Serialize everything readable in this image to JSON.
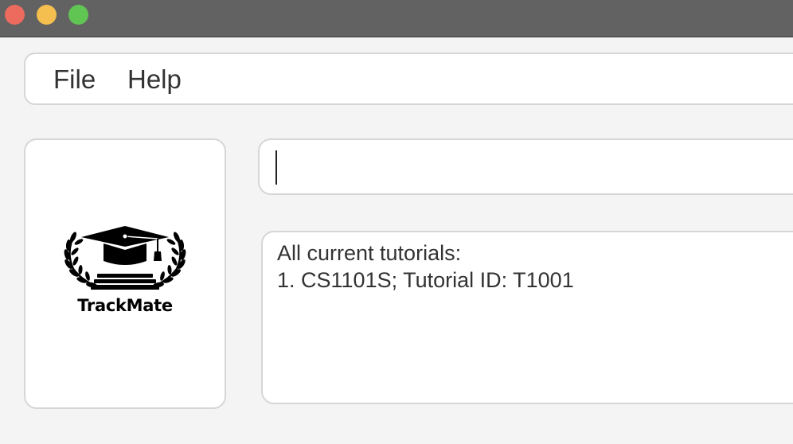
{
  "window": {
    "controls": {
      "close_color": "#ed6a5e",
      "minimize_color": "#f5bf4f",
      "zoom_color": "#61c554"
    }
  },
  "menubar": {
    "items": [
      {
        "label": "File"
      },
      {
        "label": "Help"
      }
    ]
  },
  "logo": {
    "icon": "graduation-cap-with-laurel-icon",
    "text": "TrackMate"
  },
  "command": {
    "value": "",
    "focused": true
  },
  "result": {
    "lines": [
      "All current tutorials:",
      "1. CS1101S; Tutorial ID: T1001"
    ]
  }
}
